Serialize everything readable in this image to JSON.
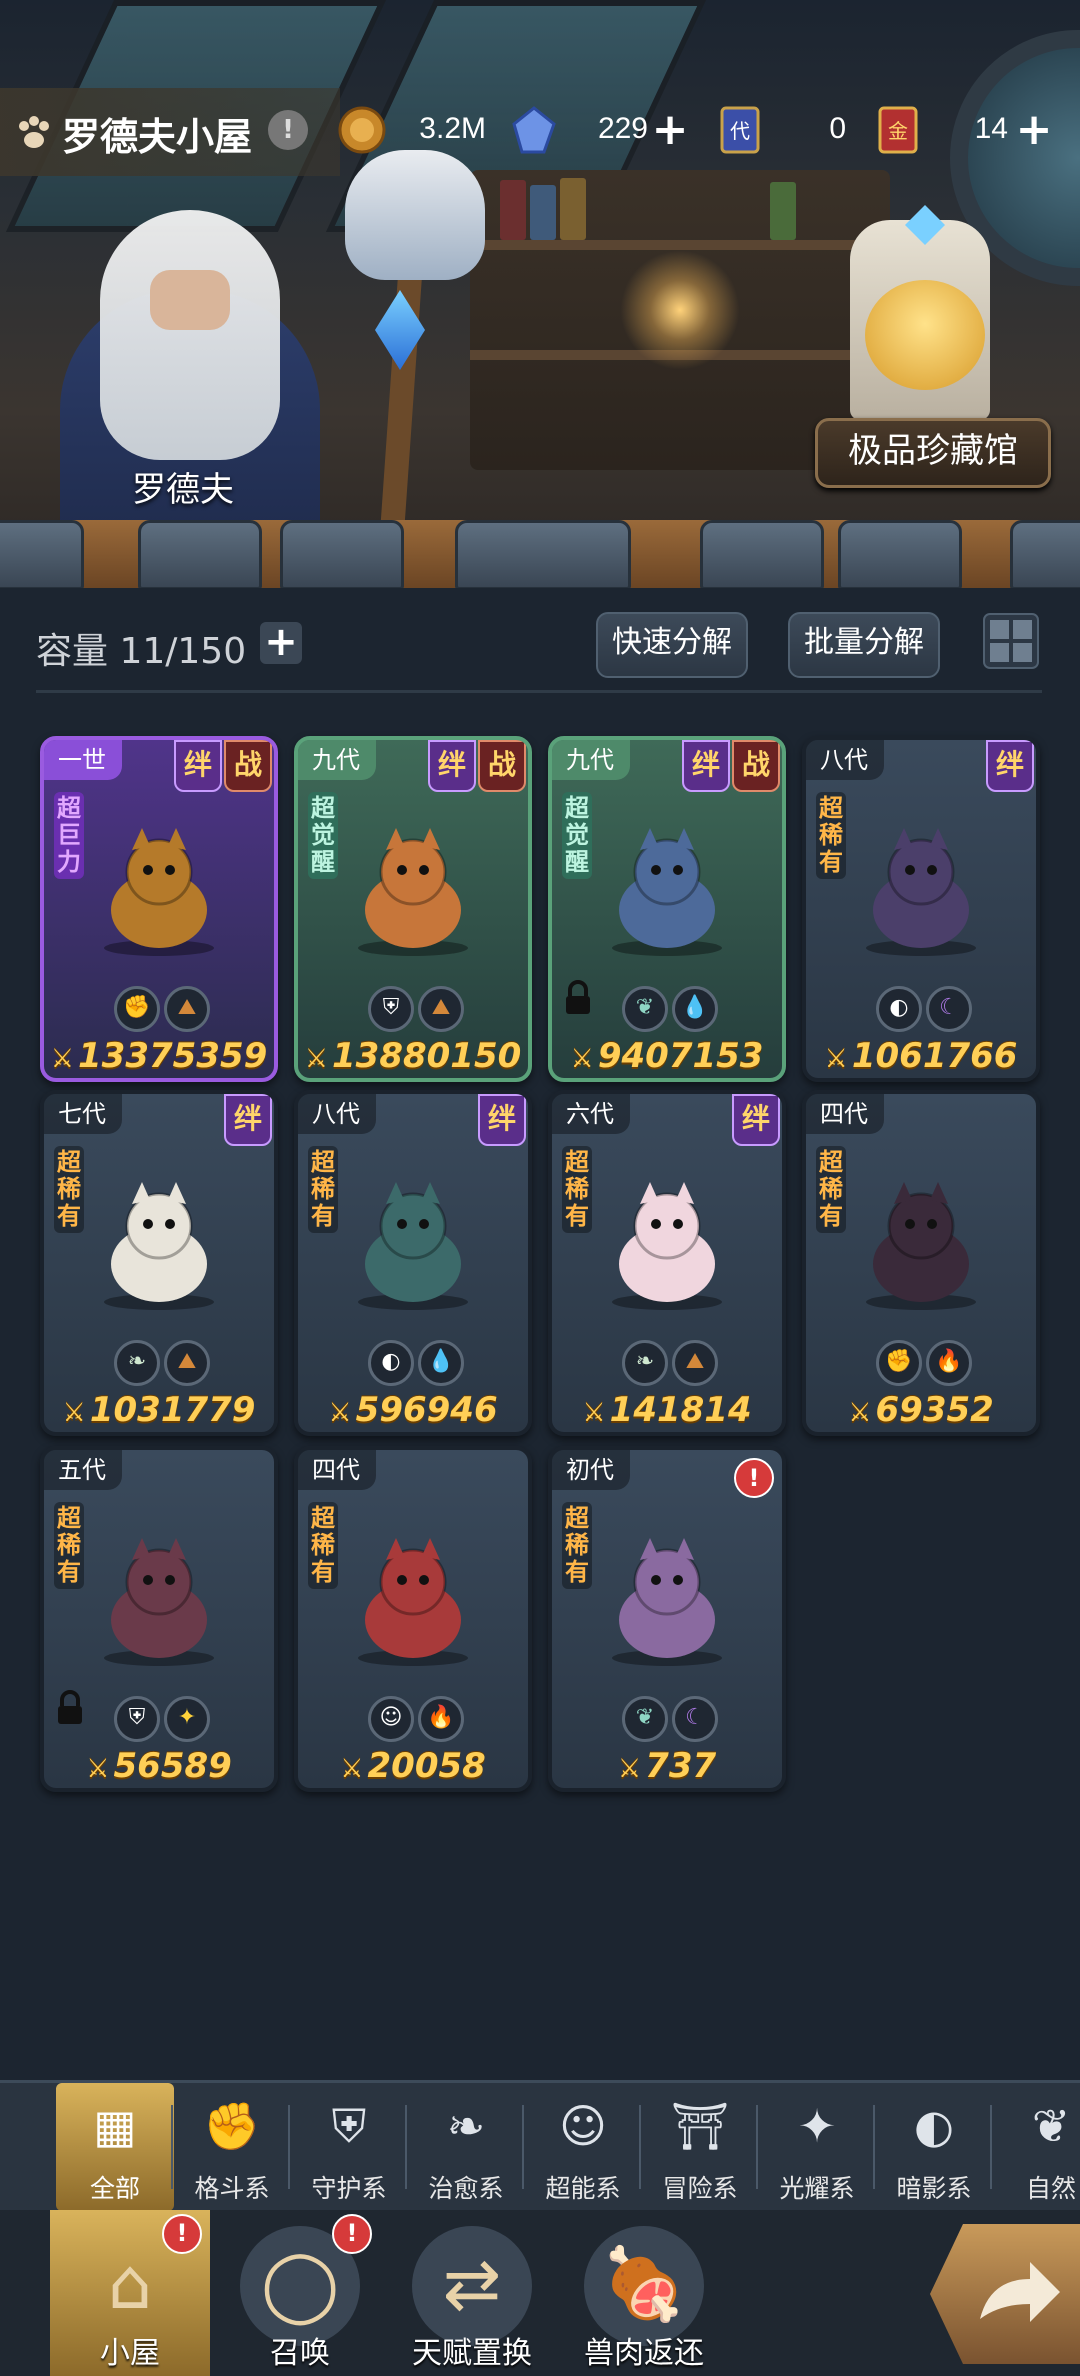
{
  "header": {
    "title": "罗德夫小屋",
    "info": "!",
    "resources": [
      {
        "icon": "gold-coin-icon",
        "value": "3.2M",
        "color": "#c8882a"
      },
      {
        "icon": "crystal-icon",
        "value": "229",
        "plus": "+",
        "color": "#5a7fd6"
      },
      {
        "icon": "generation-card-icon",
        "value": "0",
        "badge": "代",
        "color": "#3b4fa8"
      },
      {
        "icon": "gold-card-icon",
        "value": "14",
        "plus": "+",
        "badge": "金",
        "color": "#b23030"
      }
    ]
  },
  "scene": {
    "npc_name": "罗德夫",
    "museum_label": "极品珍藏馆"
  },
  "storage": {
    "capacity": "容量 11/150",
    "add": "+",
    "quick_decompose": "快速分解",
    "batch_decompose": "批量分解"
  },
  "pets": [
    {
      "gen": "一世",
      "tags": [
        "绊",
        "战"
      ],
      "rarity": "超巨力",
      "style": "purple",
      "elements": [
        "fist-icon",
        "earth-icon"
      ],
      "power": "13375359",
      "locked": false
    },
    {
      "gen": "九代",
      "tags": [
        "绊",
        "战"
      ],
      "rarity": "超觉醒",
      "style": "green",
      "elements": [
        "shield-icon",
        "earth-icon"
      ],
      "power": "13880150",
      "locked": false
    },
    {
      "gen": "九代",
      "tags": [
        "绊",
        "战"
      ],
      "rarity": "超觉醒",
      "style": "green",
      "elements": [
        "leaf-icon",
        "water-icon"
      ],
      "power": "9407153",
      "locked": true
    },
    {
      "gen": "八代",
      "tags": [
        "绊"
      ],
      "rarity": "超稀有",
      "style": "normal",
      "elements": [
        "shadow-icon",
        "moon-icon"
      ],
      "power": "1061766",
      "locked": false
    },
    {
      "gen": "七代",
      "tags": [
        "绊"
      ],
      "rarity": "超稀有",
      "style": "normal",
      "elements": [
        "sprout-icon",
        "earth-icon"
      ],
      "power": "1031779",
      "locked": false
    },
    {
      "gen": "八代",
      "tags": [
        "绊"
      ],
      "rarity": "超稀有",
      "style": "normal",
      "elements": [
        "shadow-icon",
        "water-icon"
      ],
      "power": "596946",
      "locked": false
    },
    {
      "gen": "六代",
      "tags": [
        "绊"
      ],
      "rarity": "超稀有",
      "style": "normal",
      "elements": [
        "sprout-icon",
        "earth-icon"
      ],
      "power": "141814",
      "locked": false
    },
    {
      "gen": "四代",
      "tags": [],
      "rarity": "超稀有",
      "style": "normal",
      "elements": [
        "fist-icon",
        "fire-icon"
      ],
      "power": "69352",
      "locked": false
    },
    {
      "gen": "五代",
      "tags": [],
      "rarity": "超稀有",
      "style": "normal",
      "elements": [
        "shield-icon",
        "star-icon"
      ],
      "power": "56589",
      "locked": true
    },
    {
      "gen": "四代",
      "tags": [],
      "rarity": "超稀有",
      "style": "normal",
      "elements": [
        "alien-icon",
        "fire-icon"
      ],
      "power": "20058",
      "locked": false
    },
    {
      "gen": "初代",
      "tags": [],
      "rarity": "超稀有",
      "style": "normal",
      "elements": [
        "leaf-icon",
        "moon-icon"
      ],
      "power": "737",
      "locked": false,
      "alert": "!"
    }
  ],
  "filters": [
    {
      "label": "全部",
      "icon": "all-icon",
      "active": true
    },
    {
      "label": "格斗系",
      "icon": "fist-icon"
    },
    {
      "label": "守护系",
      "icon": "shield-icon"
    },
    {
      "label": "治愈系",
      "icon": "sprout-icon"
    },
    {
      "label": "超能系",
      "icon": "alien-icon"
    },
    {
      "label": "冒险系",
      "icon": "flame-shrine-icon"
    },
    {
      "label": "光耀系",
      "icon": "star-icon"
    },
    {
      "label": "暗影系",
      "icon": "shadow-icon"
    },
    {
      "label": "自然",
      "icon": "leaf-icon"
    }
  ],
  "nav": [
    {
      "label": "小屋",
      "icon": "house-icon",
      "active": true,
      "badge": "!"
    },
    {
      "label": "召唤",
      "icon": "egg-icon",
      "badge": "!"
    },
    {
      "label": "天赋置换",
      "icon": "swap-icon"
    },
    {
      "label": "兽肉返还",
      "icon": "meat-icon"
    }
  ]
}
